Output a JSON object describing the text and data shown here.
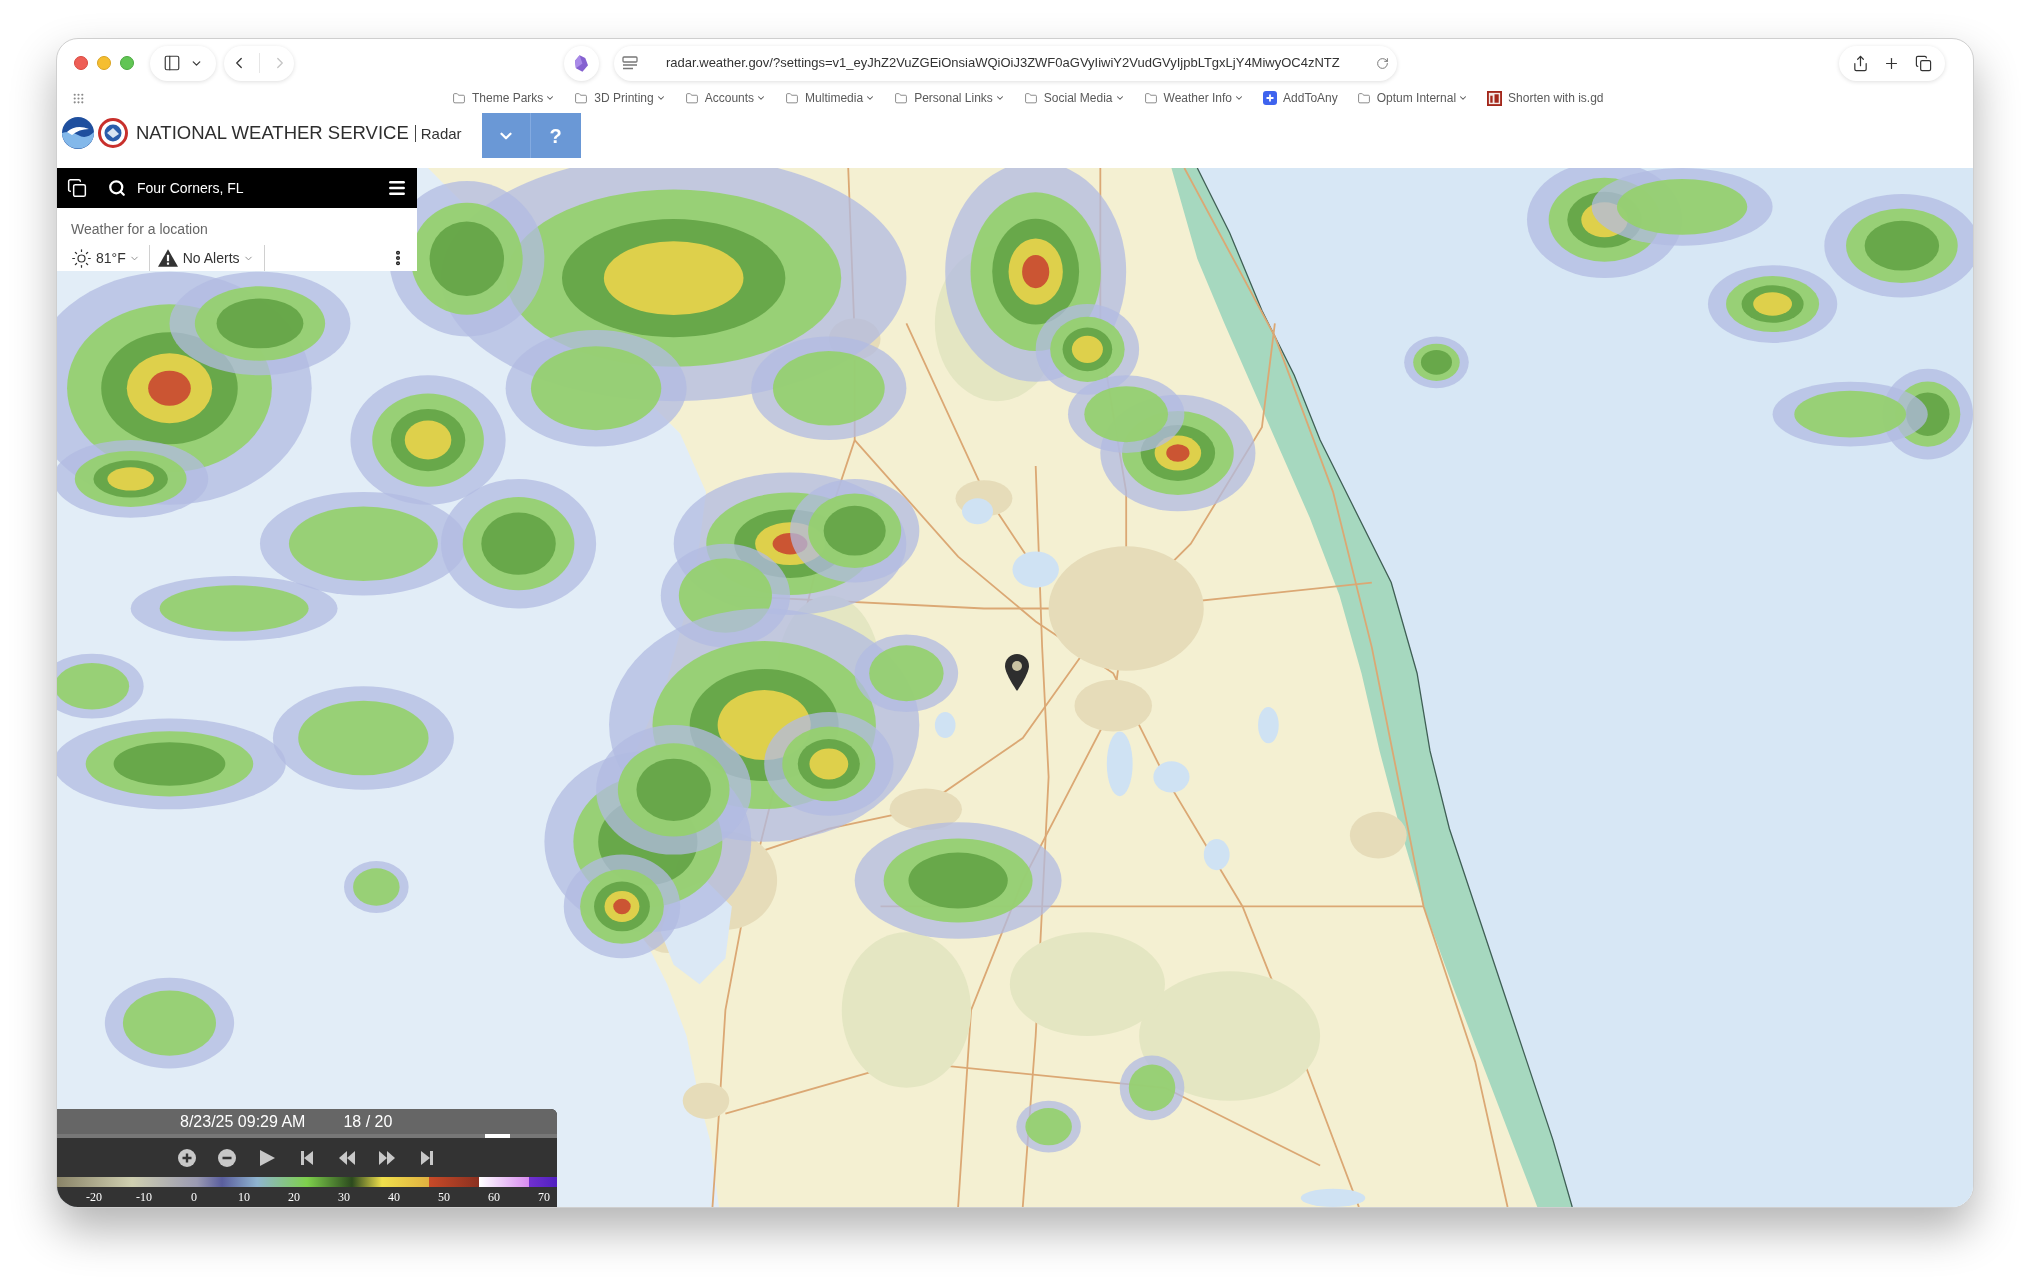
{
  "browser": {
    "forward": {
      "disabled": true
    },
    "url": "radar.weather.gov/?settings=v1_eyJhZ2VuZGEiOnsiaWQiOiJ3ZWF0aGVyIiwiY2VudGVyIjpbLTgxLjY4MiwyOC4zNTZ",
    "bookmarks": [
      {
        "label": "Theme Parks",
        "kind": "folder"
      },
      {
        "label": "3D Printing",
        "kind": "folder"
      },
      {
        "label": "Accounts",
        "kind": "folder"
      },
      {
        "label": "Multimedia",
        "kind": "folder"
      },
      {
        "label": "Personal Links",
        "kind": "folder"
      },
      {
        "label": "Social Media",
        "kind": "folder"
      },
      {
        "label": "Weather Info",
        "kind": "folder"
      },
      {
        "label": "AddToAny",
        "kind": "plus"
      },
      {
        "label": "Optum Internal",
        "kind": "folder"
      },
      {
        "label": "Shorten with is.gd",
        "kind": "logo"
      }
    ]
  },
  "header": {
    "title": "NATIONAL WEATHER SERVICE",
    "subtitle": "Radar",
    "help": "?"
  },
  "location_panel": {
    "search_value": "Four Corners, FL",
    "heading": "Weather for a location",
    "temperature": "81°F",
    "alerts": "No Alerts"
  },
  "player": {
    "timestamp": "8/23/25 09:29 AM",
    "frame": "18 / 20",
    "timeline": {
      "level": 0.9
    },
    "scale_ticks": [
      "-20",
      "-10",
      "0",
      "10",
      "20",
      "30",
      "40",
      "50",
      "60",
      "70"
    ]
  }
}
